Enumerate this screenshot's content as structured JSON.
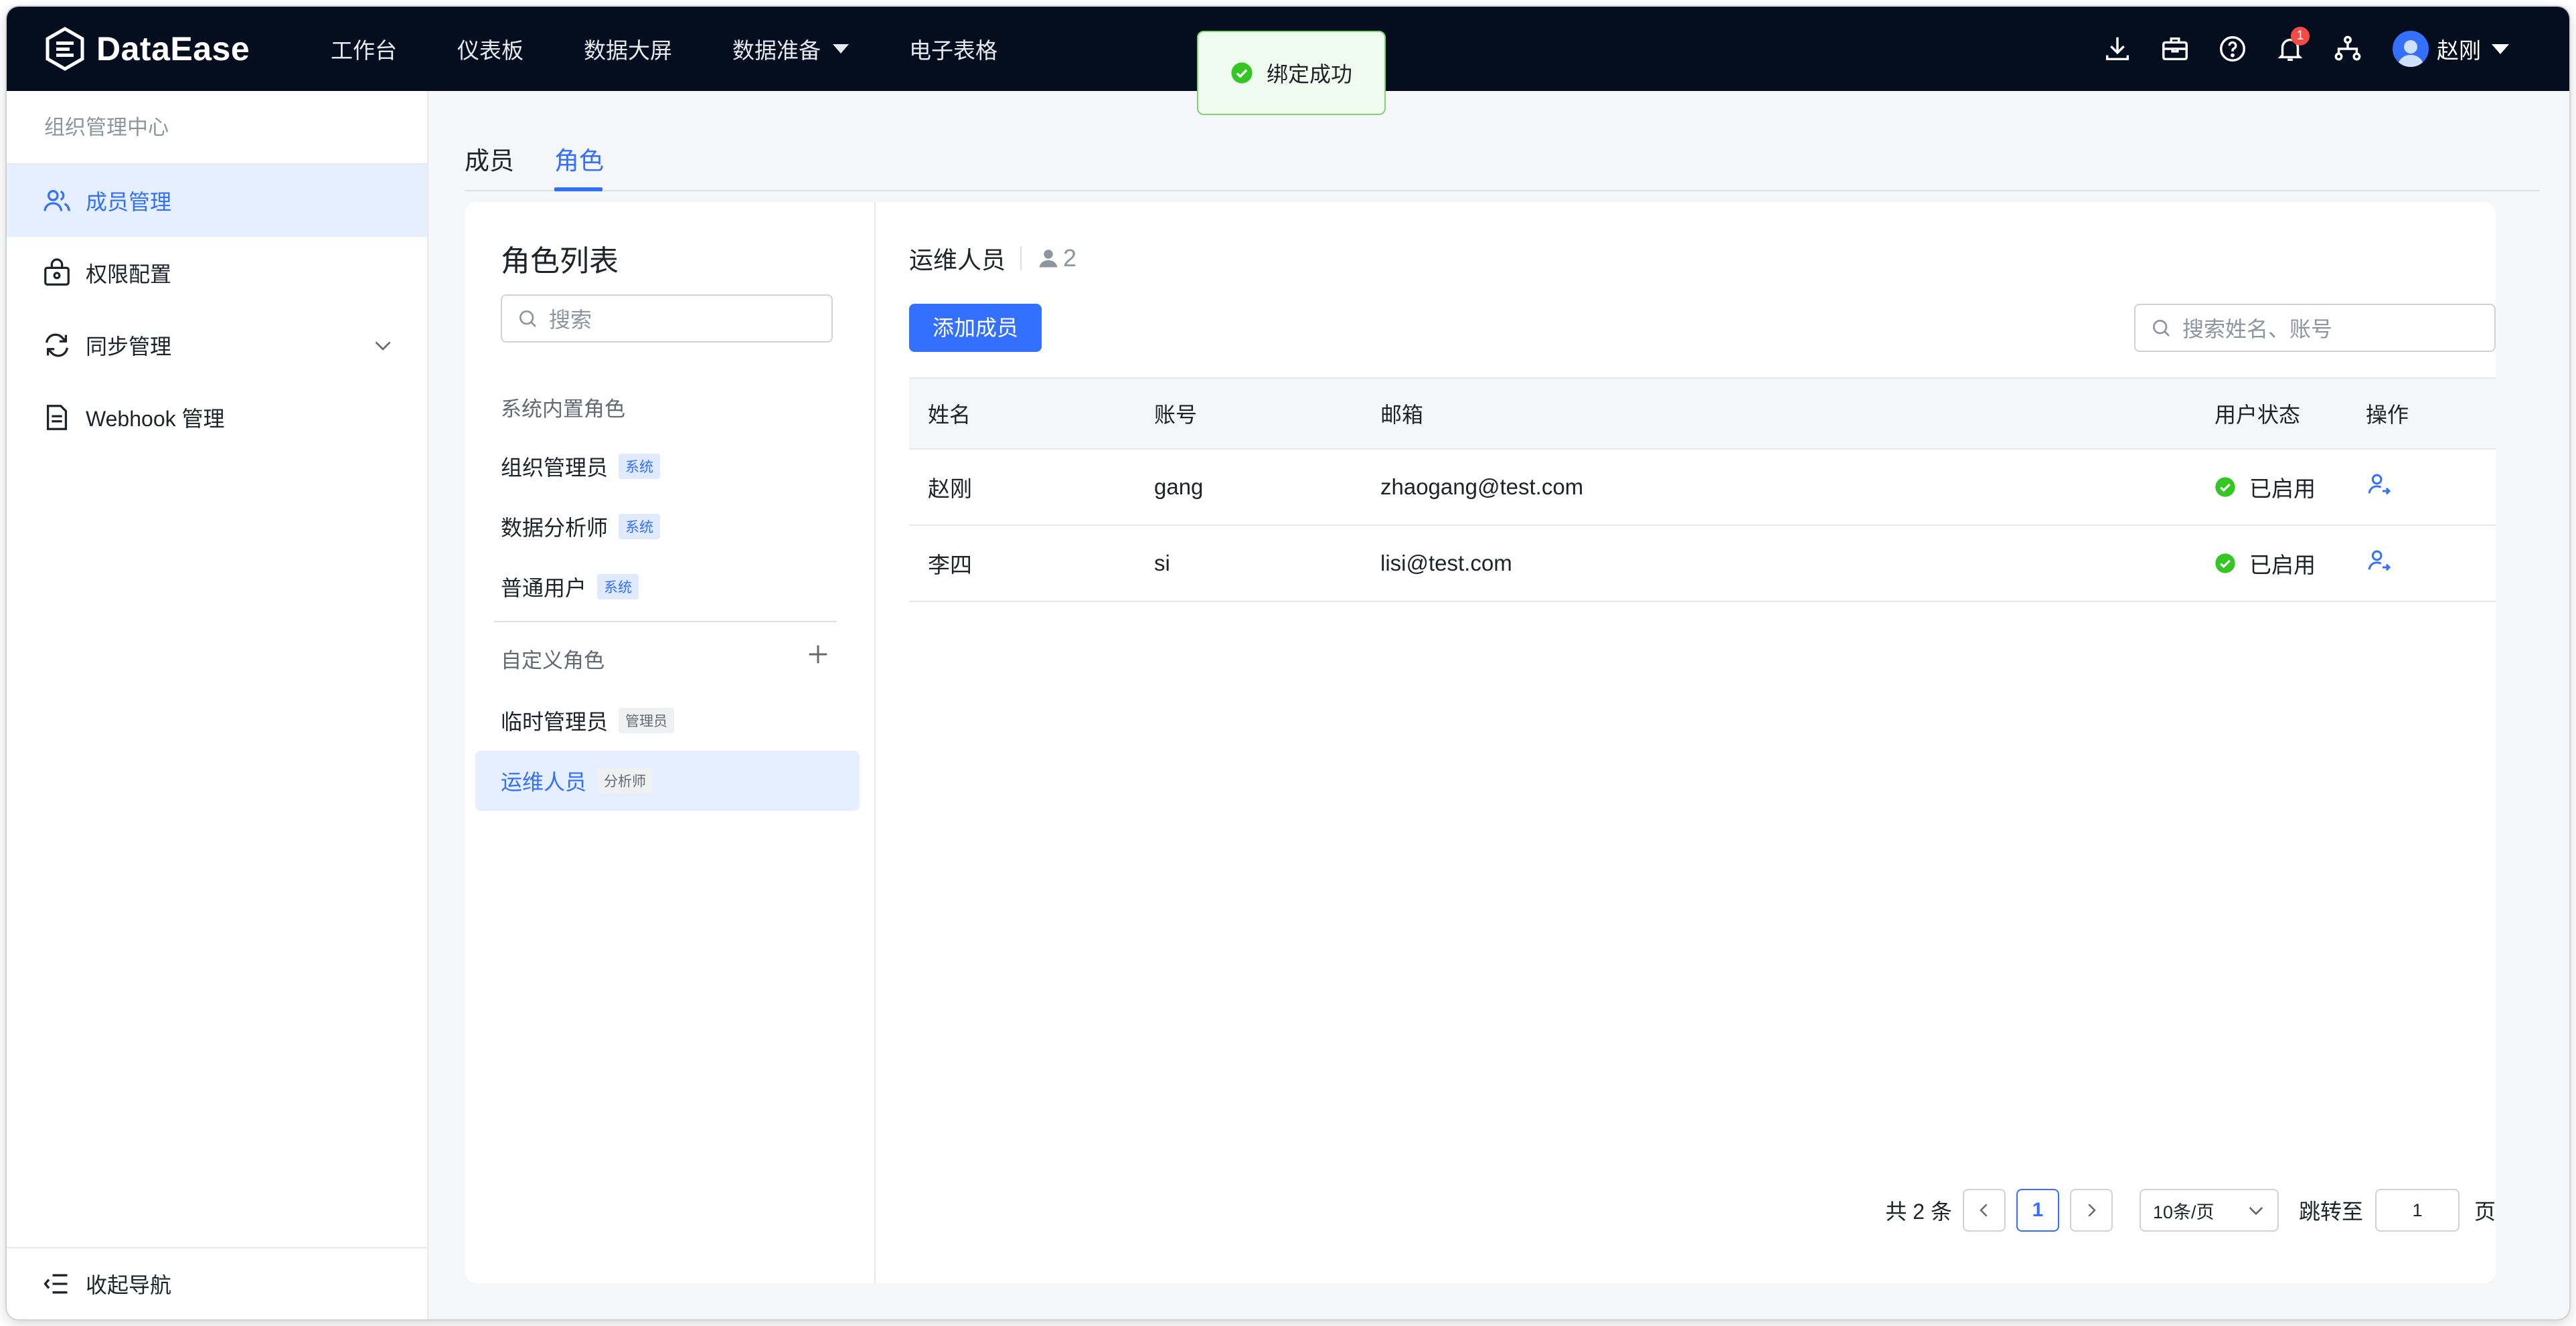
{
  "app": {
    "name": "DataEase"
  },
  "nav": {
    "items": [
      {
        "label": "工作台"
      },
      {
        "label": "仪表板"
      },
      {
        "label": "数据大屏"
      },
      {
        "label": "数据准备"
      },
      {
        "label": "电子表格"
      }
    ]
  },
  "header": {
    "notification_count": "1",
    "user_name": "赵刚"
  },
  "toast": {
    "message": "绑定成功"
  },
  "sidebar": {
    "title": "组织管理中心",
    "items": [
      {
        "label": "成员管理",
        "icon": "users-icon",
        "active": true
      },
      {
        "label": "权限配置",
        "icon": "lock-box-icon"
      },
      {
        "label": "同步管理",
        "icon": "sync-icon"
      },
      {
        "label": "Webhook 管理",
        "icon": "document-icon"
      }
    ],
    "collapse_label": "收起导航"
  },
  "tabs": [
    {
      "label": "成员"
    },
    {
      "label": "角色",
      "active": true
    }
  ],
  "roles": {
    "title": "角色列表",
    "search_placeholder": "搜索",
    "builtin_label": "系统内置角色",
    "builtin": [
      {
        "name": "组织管理员",
        "tag": "系统"
      },
      {
        "name": "数据分析师",
        "tag": "系统"
      },
      {
        "name": "普通用户",
        "tag": "系统"
      }
    ],
    "custom_label": "自定义角色",
    "custom": [
      {
        "name": "临时管理员",
        "tag": "管理员"
      },
      {
        "name": "运维人员",
        "tag": "分析师",
        "active": true
      }
    ]
  },
  "detail": {
    "role_name": "运维人员",
    "member_count": "2",
    "add_button": "添加成员",
    "search_placeholder": "搜索姓名、账号",
    "columns": [
      "姓名",
      "账号",
      "邮箱",
      "用户状态",
      "操作"
    ],
    "rows": [
      {
        "name": "赵刚",
        "account": "gang",
        "email": "zhaogang@test.com",
        "status": "已启用"
      },
      {
        "name": "李四",
        "account": "si",
        "email": "lisi@test.com",
        "status": "已启用"
      }
    ]
  },
  "pagination": {
    "total_label": "共 2 条",
    "current_page": "1",
    "page_size": "10条/页",
    "jump_label": "跳转至",
    "jump_value": "1",
    "page_unit": "页"
  },
  "colors": {
    "primary": "#3370ff",
    "topbar": "#050e1e",
    "success": "#34c724"
  }
}
